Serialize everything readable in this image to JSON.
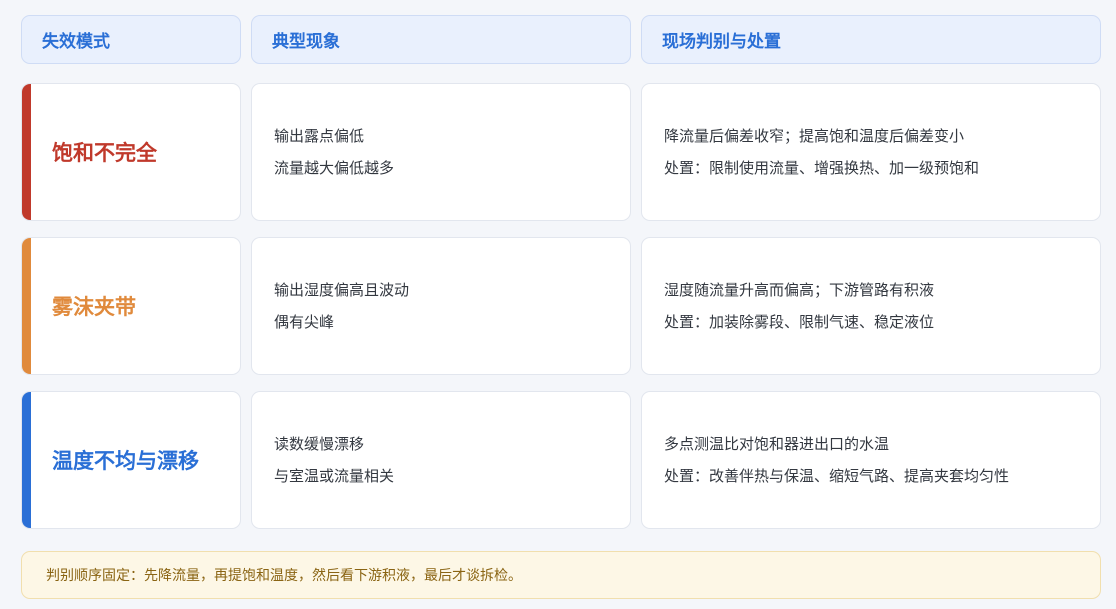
{
  "header": {
    "mode": "失效模式",
    "symptom": "典型现象",
    "action": "现场判别与处置"
  },
  "rows": [
    {
      "mode": "饱和不完全",
      "color": "#c0392b",
      "symptom": [
        "输出露点偏低",
        "流量越大偏低越多"
      ],
      "action": [
        "降流量后偏差收窄；提高饱和温度后偏差变小",
        "处置：限制使用流量、增强换热、加一级预饱和"
      ]
    },
    {
      "mode": "雾沫夹带",
      "color": "#e08a3c",
      "symptom": [
        "输出湿度偏高且波动",
        "偶有尖峰"
      ],
      "action": [
        "湿度随流量升高而偏高；下游管路有积液",
        "处置：加装除雾段、限制气速、稳定液位"
      ]
    },
    {
      "mode": "温度不均与漂移",
      "color": "#2a6fd6",
      "symptom": [
        "读数缓慢漂移",
        "与室温或流量相关"
      ],
      "action": [
        "多点测温比对饱和器进出口的水温",
        "处置：改善伴热与保温、缩短气路、提高夹套均匀性"
      ]
    }
  ],
  "note": "判别顺序固定：先降流量，再提饱和温度，然后看下游积液，最后才谈拆检。"
}
